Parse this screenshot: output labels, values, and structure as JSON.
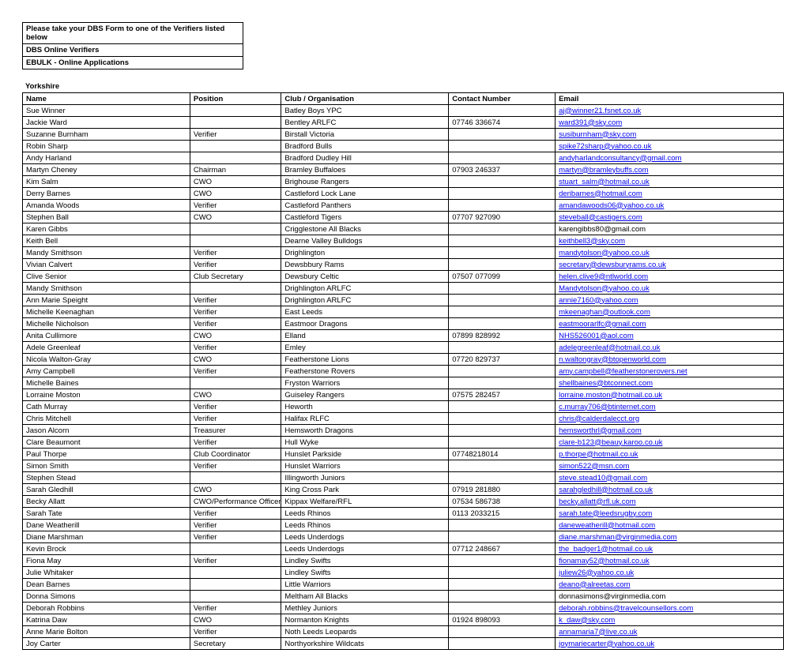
{
  "info_lines": [
    "Please take your DBS Form to one of the Verifiers listed below",
    "DBS Online Verifiers",
    "EBULK - Online Applications"
  ],
  "section_title": "Yorkshire",
  "headers": {
    "name": "Name",
    "position": "Position",
    "org": "Club / Organisation",
    "contact": "Contact Number",
    "email": "Email"
  },
  "rows": [
    {
      "name": "Sue Winner",
      "position": "",
      "org": "Batley Boys YPC",
      "contact": "",
      "email": "aj@winner21.fsnet.co.uk",
      "link": true
    },
    {
      "name": "Jackie Ward",
      "position": "",
      "org": "Bentley ARLFC",
      "contact": "07746 336674",
      "email": "ward391@sky.com",
      "link": true
    },
    {
      "name": "Suzanne Burnham",
      "position": "Verifier",
      "org": "Birstall Victoria",
      "contact": "",
      "email": "susiburnham@sky.com",
      "link": true
    },
    {
      "name": "Robin Sharp",
      "position": "",
      "org": "Bradford Bulls",
      "contact": "",
      "email": "spike72sharp@yahoo.co.uk",
      "link": true
    },
    {
      "name": "Andy Harland",
      "position": "",
      "org": "Bradford Dudley Hill",
      "contact": "",
      "email": "andyharlandconsultancy@gmail.com",
      "link": true
    },
    {
      "name": "Martyn Cheney",
      "position": "Chairman",
      "org": "Bramley Buffaloes",
      "contact": "07903 246337",
      "email": "martyn@bramleybuffs.com",
      "link": true
    },
    {
      "name": "Kim Salm",
      "position": "CWO",
      "org": "Brighouse Rangers",
      "contact": "",
      "email": "stuart_salm@hotmail.co.uk",
      "link": true
    },
    {
      "name": "Derry Barnes",
      "position": "CWO",
      "org": "Castleford Lock Lane",
      "contact": "",
      "email": "deribarnes@hotmail.com",
      "link": true
    },
    {
      "name": "Amanda Woods",
      "position": "Verifier",
      "org": "Castleford Panthers",
      "contact": "",
      "email": "amandawoods06@yahoo.co.uk",
      "link": true
    },
    {
      "name": "Stephen Ball",
      "position": "CWO",
      "org": "Castleford Tigers",
      "contact": "07707 927090",
      "email": "steveball@castigers.com",
      "link": true
    },
    {
      "name": "Karen Gibbs",
      "position": "",
      "org": "Crigglestone All Blacks",
      "contact": "",
      "email": "karengibbs80@gmail.com",
      "link": false
    },
    {
      "name": "Keith Bell",
      "position": "",
      "org": "Dearne Valley Bulldogs",
      "contact": "",
      "email": "keithbell3@sky.com",
      "link": true
    },
    {
      "name": "Mandy Smithson",
      "position": "Verifier",
      "org": "Drighlington",
      "contact": "",
      "email": "mandytolson@yahoo.co.uk",
      "link": true
    },
    {
      "name": "Vivian Calvert",
      "position": "Verifier",
      "org": "Dewsbbury Rams",
      "contact": "",
      "email": "secretary@dewsburyrams.co.uk",
      "link": true
    },
    {
      "name": "Clive Senior",
      "position": " Club Secretary",
      "org": "Dewsbury Celtic",
      "contact": "07507 077099",
      "email": " helen.clive9@ntlworld.com",
      "link": true
    },
    {
      "name": "Mandy Smithson",
      "position": "",
      "org": "Drighlington ARLFC",
      "contact": "",
      "email": "Mandytolson@yahoo.co.uk",
      "link": true
    },
    {
      "name": "Ann Marie Speight",
      "position": "Verifier",
      "org": "Drighlington ARLFC",
      "contact": "",
      "email": "annie7160@yahoo.com",
      "link": true
    },
    {
      "name": "Michelle Keenaghan",
      "position": "Verifier",
      "org": "East Leeds",
      "contact": "",
      "email": "mkeenaghan@outlook.com",
      "link": true
    },
    {
      "name": "Michelle Nicholson",
      "position": "Verifier",
      "org": "Eastmoor Dragons",
      "contact": "",
      "email": "eastmoorarlfc@gmail.com",
      "link": true
    },
    {
      "name": "Anita Cullimore",
      "position": "CWO",
      "org": "Elland",
      "contact": "07899 828992",
      "email": "NHS526001@aol.com",
      "link": true
    },
    {
      "name": "Adele Greenleaf",
      "position": "Verifier",
      "org": "Emley",
      "contact": "",
      "email": "adelegreenleaf@hotmail.co.uk",
      "link": true
    },
    {
      "name": "Nicola Walton-Gray",
      "position": "CWO",
      "org": "Featherstone Lions",
      "contact": "07720 829737",
      "email": "n.waltongray@btopenworld.com",
      "link": true
    },
    {
      "name": "Amy Campbell",
      "position": "Verifier",
      "org": "Featherstone Rovers",
      "contact": "",
      "email": "amy.campbell@featherstonerovers.net",
      "link": true
    },
    {
      "name": "Michelle Baines",
      "position": "",
      "org": "Fryston Warriors",
      "contact": "",
      "email": "shellbaines@btconnect.com",
      "link": true
    },
    {
      "name": "Lorraine Moston",
      "position": "CWO",
      "org": "Guiseley Rangers",
      "contact": "07575 282457",
      "email": "lorraine.moston@hotmail.co.uk",
      "link": true
    },
    {
      "name": "Cath Murray",
      "position": "Verifier",
      "org": "Heworth",
      "contact": "",
      "email": "c.murray706@btinternet.com",
      "link": true
    },
    {
      "name": "Chris Mitchell",
      "position": "Verifier",
      "org": "Halifax RLFC",
      "contact": "",
      "email": "chris@calderdalecct.org",
      "link": true
    },
    {
      "name": "Jason Alcorn",
      "position": "Treasurer",
      "org": "Hemsworth Dragons",
      "contact": "",
      "email": "hemsworthrl@gmail.com",
      "link": true
    },
    {
      "name": "Clare Beaumont",
      "position": "Verifier",
      "org": "Hull Wyke",
      "contact": "",
      "email": "clare-b123@beauy.karoo.co.uk",
      "link": true
    },
    {
      "name": "Paul Thorpe",
      "position": "Club Coordinator",
      "org": "Hunslet Parkside",
      "contact": "07748218014",
      "email": "p.thorpe@hotmail.co.uk",
      "link": true
    },
    {
      "name": "Simon Smith",
      "position": "Verifier",
      "org": "Hunslet Warriors",
      "contact": "",
      "email": "simon522@msn.com",
      "link": true
    },
    {
      "name": "Stephen Stead",
      "position": "",
      "org": "Illingworth Juniors",
      "contact": "",
      "email": "steve.stead10@gmail.com",
      "link": true
    },
    {
      "name": "Sarah Gledhill",
      "position": "CWO",
      "org": "King Cross Park",
      "contact": "07919 281880",
      "email": "sarahgledhill@hotmail.co.uk",
      "link": true
    },
    {
      "name": "Becky Allatt",
      "position": "CWO/Performance Officer",
      "org": "Kippax Welfare/RFL",
      "contact": "07534 586738",
      "email": "becky.allatt@rfl.uk.com",
      "link": true
    },
    {
      "name": "Sarah Tate",
      "position": "Verifier",
      "org": "Leeds Rhinos",
      "contact": "0113 2033215",
      "email": "sarah.tate@leedsrugby.com",
      "link": true
    },
    {
      "name": "Dane Weatherill",
      "position": "Verifier",
      "org": "Leeds Rhinos",
      "contact": "",
      "email": "daneweatherill@hotmail.com",
      "link": true
    },
    {
      "name": "Diane Marshman",
      "position": "Verifier",
      "org": "Leeds Underdogs",
      "contact": "",
      "email": "diane.marshman@virginmedia.com",
      "link": true
    },
    {
      "name": "Kevin Brock",
      "position": "",
      "org": "Leeds Underdogs",
      "contact": "07712 248667",
      "email": "the_badger1@hotmail.co.uk",
      "link": true
    },
    {
      "name": "Fiona May",
      "position": "Verifier",
      "org": "Lindley Swifts",
      "contact": "",
      "email": "fionamay52@hotmail.co.uk",
      "link": true
    },
    {
      "name": "Julie Whitaker",
      "position": "",
      "org": "Lindley Swifts",
      "contact": "",
      "email": "juliew26@yahoo.co.uk",
      "link": true
    },
    {
      "name": "Dean Barnes",
      "position": "",
      "org": "Little Warriors",
      "contact": "",
      "email": "deano@alreetas.com",
      "link": true
    },
    {
      "name": "Donna Simons",
      "position": "",
      "org": "Meltham All Blacks",
      "contact": "",
      "email": "donnasimons@virginmedia.com",
      "link": false
    },
    {
      "name": "Deborah Robbins",
      "position": "Verifier",
      "org": "Methley Juniors",
      "contact": "",
      "email": "deborah.robbins@travelcounsellors.com",
      "link": true
    },
    {
      "name": "Katrina Daw",
      "position": "CWO",
      "org": "Normanton Knights",
      "contact": "01924 898093",
      "email": "k_daw@sky.com",
      "link": true
    },
    {
      "name": "Anne Marie Bolton",
      "position": "Verifier",
      "org": "Noth Leeds Leopards",
      "contact": "",
      "email": "annamaria7@live.co.uk",
      "link": true
    },
    {
      "name": "Joy Carter",
      "position": "Secretary",
      "org": "Northyorkshire Wildcats",
      "contact": "",
      "email": "joymariecarter@yahoo.co.uk",
      "link": true
    }
  ]
}
